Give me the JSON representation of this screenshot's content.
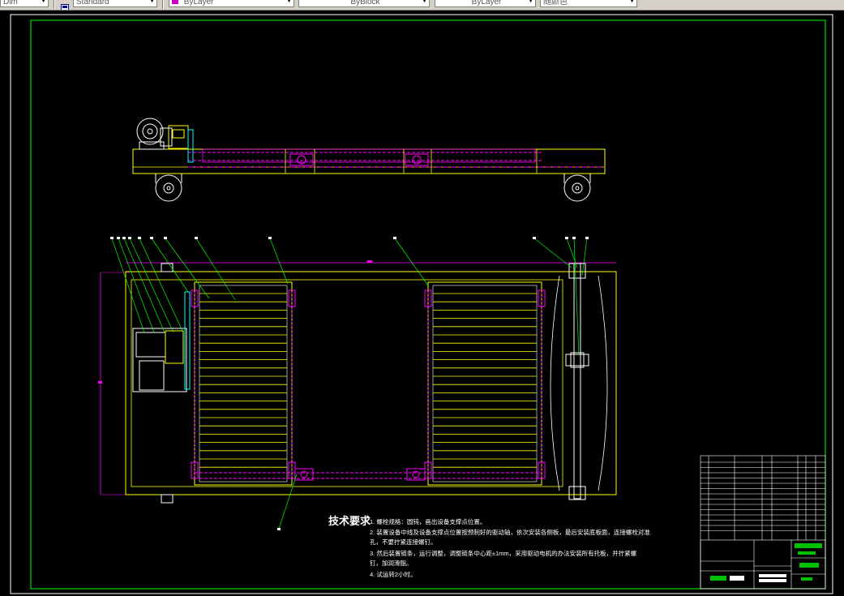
{
  "toolbar": {
    "dim_style": "Dim",
    "text_style": "Standard",
    "color": "ByLayer",
    "linetype": "ByBlock",
    "lineweight": "ByLayer",
    "plot_style": "随颜色"
  },
  "notes": {
    "heading": "技术要求",
    "items": [
      "1.  螺栓规格：圆钝，画出设备支撑点位置。",
      "2.  装置设备中线及设备支撑点位置按预制好的驱动轴，依次安装各侧板，最后安装底板面，连接螺栓对准",
      "     孔，不要拧紧连接螺钉。",
      "3.  然后装置链条，运行调整，调整链条中心距±1mm，采用驱动电机的办法安装所有托板，并拧紧螺",
      "     钉，加润滑脂。",
      "4.  试运转2小时。"
    ]
  },
  "colors": {
    "frame": "#ffff00",
    "chain": "#ff00ff",
    "leader": "#00ff00",
    "border": "#00ff00",
    "dimension": "#ff00ff"
  },
  "icons": {
    "text_style_icon": "text-style-icon",
    "color_swatch_icon": "color-swatch-icon"
  }
}
